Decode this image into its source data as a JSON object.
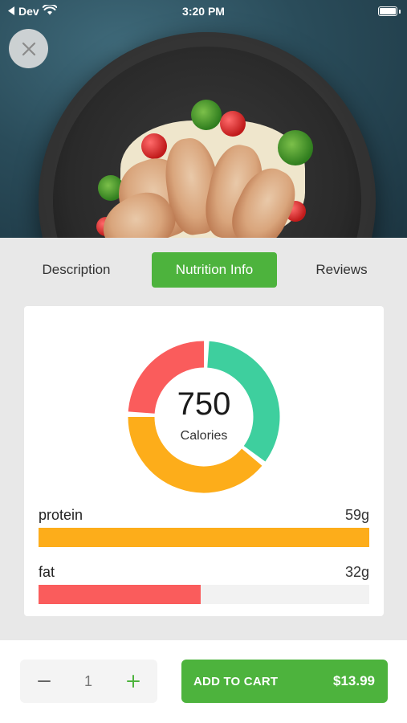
{
  "status_bar": {
    "carrier": "Dev",
    "time": "3:20 PM"
  },
  "hero": {
    "image_icon": "food-photo"
  },
  "close_icon": "close-icon",
  "tabs": [
    {
      "label": "Description",
      "active": false
    },
    {
      "label": "Nutrition Info",
      "active": true
    },
    {
      "label": "Reviews",
      "active": false
    }
  ],
  "nutrition": {
    "calories_value": "750",
    "calories_label": "Calories",
    "donut_segments": [
      {
        "color": "#3ecf9e",
        "fraction": 0.35
      },
      {
        "color": "#fdad1a",
        "fraction": 0.4
      },
      {
        "color": "#fa5c5c",
        "fraction": 0.25
      }
    ],
    "items": [
      {
        "name": "protein",
        "amount": "59g",
        "fill_fraction": 1.0,
        "color": "#fdad1a"
      },
      {
        "name": "fat",
        "amount": "32g",
        "fill_fraction": 0.49,
        "color": "#fa5c5c"
      }
    ]
  },
  "cart": {
    "quantity": "1",
    "add_label": "ADD TO CART",
    "price": "$13.99"
  },
  "colors": {
    "accent_green": "#4db33d",
    "background": "#e8e8e8"
  }
}
